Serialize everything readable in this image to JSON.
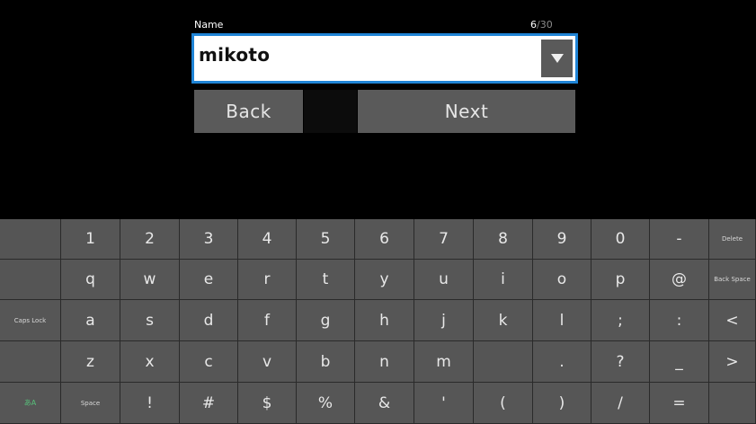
{
  "form": {
    "label": "Name",
    "char_count_current": "6",
    "char_count_max": "/30",
    "value": "mikoto",
    "dropdown_icon": "triangle-down-icon"
  },
  "buttons": {
    "back": "Back",
    "next": "Next"
  },
  "keyboard": {
    "rows": [
      [
        "",
        "1",
        "2",
        "3",
        "4",
        "5",
        "6",
        "7",
        "8",
        "9",
        "0",
        "-",
        "Delete"
      ],
      [
        "",
        "q",
        "w",
        "e",
        "r",
        "t",
        "y",
        "u",
        "i",
        "o",
        "p",
        "@",
        "Back Space"
      ],
      [
        "Caps Lock",
        "a",
        "s",
        "d",
        "f",
        "g",
        "h",
        "j",
        "k",
        "l",
        ";",
        ":",
        "<"
      ],
      [
        "",
        "z",
        "x",
        "c",
        "v",
        "b",
        "n",
        "m",
        "",
        ".",
        "?",
        "_",
        ">"
      ],
      [
        "あA",
        "Space",
        "!",
        "#",
        "$",
        "%",
        "&",
        "'",
        "(",
        ")",
        "/",
        "=",
        ""
      ]
    ]
  },
  "colors": {
    "background": "#000000",
    "key": "#565656",
    "input_border": "#1f84d6",
    "button": "#5a5a5a"
  }
}
